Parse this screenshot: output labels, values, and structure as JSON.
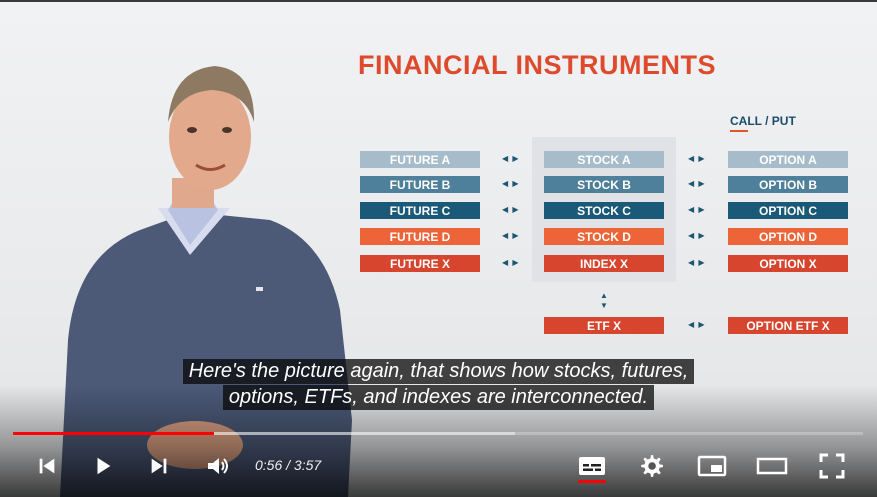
{
  "slide": {
    "title": "FINANCIAL INSTRUMENTS",
    "call_put": "CALL / PUT",
    "futures": [
      "FUTURE A",
      "FUTURE B",
      "FUTURE C",
      "FUTURE D",
      "FUTURE X"
    ],
    "stocks": [
      "STOCK A",
      "STOCK B",
      "STOCK C",
      "STOCK D",
      "INDEX X"
    ],
    "options": [
      "OPTION A",
      "OPTION B",
      "OPTION C",
      "OPTION D",
      "OPTION X"
    ],
    "etf": "ETF X",
    "option_etf": "OPTION ETF X",
    "arrow_glyph": "◀ ▶",
    "colors": [
      "#a6bccb",
      "#4e7f9b",
      "#1a5a78",
      "#ec6437",
      "#d7452f"
    ]
  },
  "captions": {
    "line1": "Here's the picture again, that shows how stocks, futures,",
    "line2": "options, ETFs, and indexes are interconnected."
  },
  "player": {
    "current_time": "0:56",
    "separator": " / ",
    "duration": "3:57",
    "progress_fraction": 0.236,
    "buffered_fraction": 0.59,
    "progress_color": "#ff0000",
    "controls": [
      "previous-icon",
      "play-icon",
      "next-icon",
      "volume-icon",
      "subtitles-icon",
      "gear-icon",
      "miniplayer-icon",
      "theater-icon",
      "fullscreen-icon"
    ]
  }
}
